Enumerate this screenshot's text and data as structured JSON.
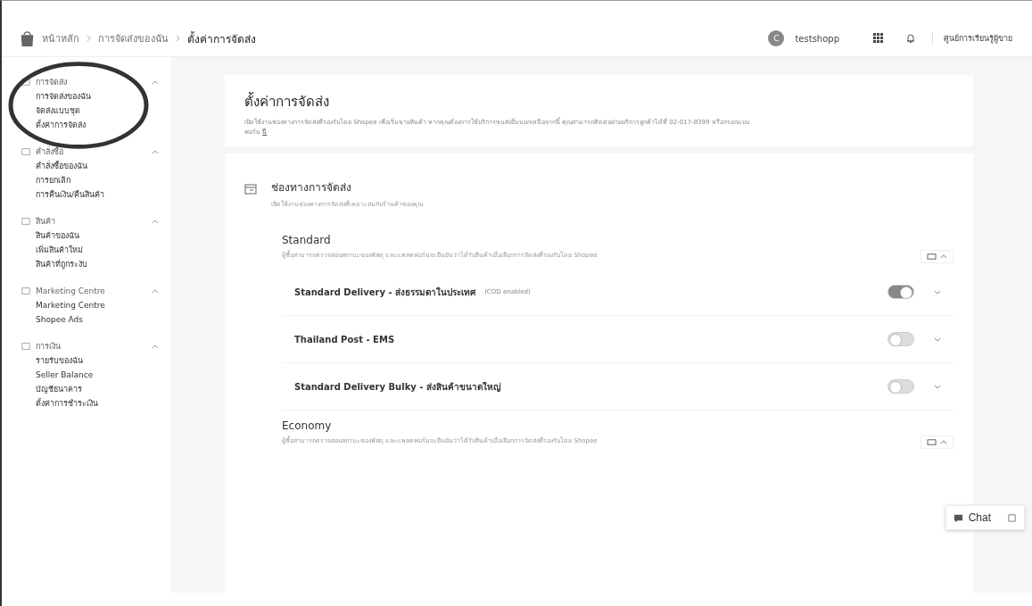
{
  "breadcrumb": [
    "หน้าหลัก",
    "การจัดส่งของฉัน",
    "ตั้งค่าการจัดส่ง"
  ],
  "header": {
    "user": "testshopp",
    "avatar_letter": "C",
    "learning_link": "ศูนย์การเรียนรู้ผู้ขาย"
  },
  "sidebar": [
    {
      "title": "การจัดส่ง",
      "expanded": true,
      "highlighted": true,
      "items": [
        "การจัดส่งของฉัน",
        "จัดส่งแบบชุด",
        "ตั้งค่าการจัดส่ง"
      ]
    },
    {
      "title": "คำสั่งซื้อ",
      "expanded": true,
      "highlighted": false,
      "items": [
        "คำสั่งซื้อของฉัน",
        "การยกเลิก",
        "การคืนเงิน/คืนสินค้า"
      ]
    },
    {
      "title": "สินค้า",
      "expanded": true,
      "highlighted": false,
      "items": [
        "สินค้าของฉัน",
        "เพิ่มสินค้าใหม่",
        "สินค้าที่ถูกระงับ"
      ]
    },
    {
      "title": "Marketing Centre",
      "expanded": true,
      "highlighted": false,
      "items": [
        "Marketing Centre",
        "Shopee Ads"
      ]
    },
    {
      "title": "การเงิน",
      "expanded": true,
      "highlighted": false,
      "items": [
        "รายรับของฉัน",
        "Seller Balance",
        "บัญชีธนาคาร",
        "ตั้งค่าการชำระเงิน"
      ]
    }
  ],
  "page": {
    "title": "ตั้งค่าการจัดส่ง",
    "description": "เปิดใช้งานช่องทางการจัดส่งที่รองรับโดย Shopee เพื่อเริ่มขายสินค้า หากคุณต้องการใช้บริการขนส่งอื่นนอกเหนือจากนี้ คุณสามารถติดต่อฝ่ายบริการลูกค้าได้ที่ 02-017-8399 หรือกรอกแบบ",
    "description_more": "ฟอร์ม",
    "link": "นี่"
  },
  "section": {
    "title": "ช่องทางการจัดส่ง",
    "subtitle": "เปิดใช้งานช่องทางการจัดส่งที่เหมาะสมกับร้านค้าของคุณ"
  },
  "groups": [
    {
      "title": "Standard",
      "description": "ผู้ซื้อสามารถตรวจสอบสถานะของพัสดุ และแพลตฟอร์มจะยืนยันว่าได้รับสินค้าเมื่อเลือกการจัดส่งที่รองรับโดย Shopee",
      "expanded": true,
      "channels": [
        {
          "name": "Standard Delivery - ส่งธรรมดาในประเทศ",
          "note": "(COD enabled)",
          "on": true
        },
        {
          "name": "Thailand Post - EMS",
          "on": false
        },
        {
          "name": "Standard Delivery Bulky - ส่งสินค้าขนาดใหญ่",
          "on": false
        }
      ]
    },
    {
      "title": "Economy",
      "description": "ผู้ซื้อสามารถตรวจสอบสถานะของพัสดุ และแพลตฟอร์มจะยืนยันว่าได้รับสินค้าเมื่อเลือกการจัดส่งที่รองรับโดย Shopee",
      "expanded": true
    }
  ],
  "chat": {
    "label": "Chat"
  }
}
